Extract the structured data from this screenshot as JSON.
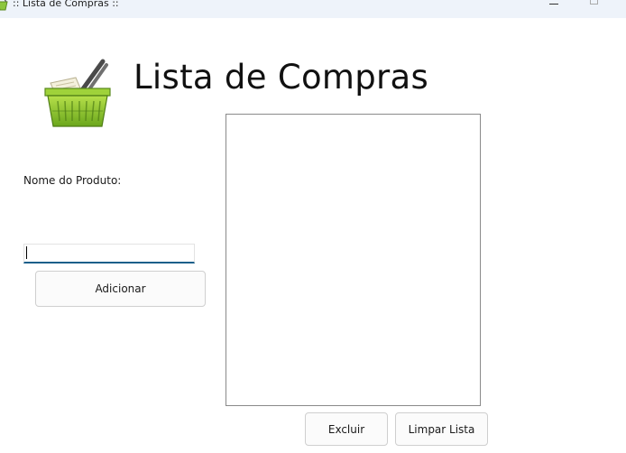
{
  "window": {
    "title": ":: Lista de Compras ::"
  },
  "header": {
    "heading": "Lista de Compras",
    "logo_icon": "shopping-basket-icon"
  },
  "form": {
    "product_label": "Nome do Produto:",
    "product_input_value": "",
    "add_button_label": "Adicionar"
  },
  "list": {
    "items": []
  },
  "actions": {
    "delete_label": "Excluir",
    "clear_label": "Limpar Lista"
  },
  "colors": {
    "basket_green": "#8dc63f",
    "input_focus_border": "#1a5f8a"
  }
}
